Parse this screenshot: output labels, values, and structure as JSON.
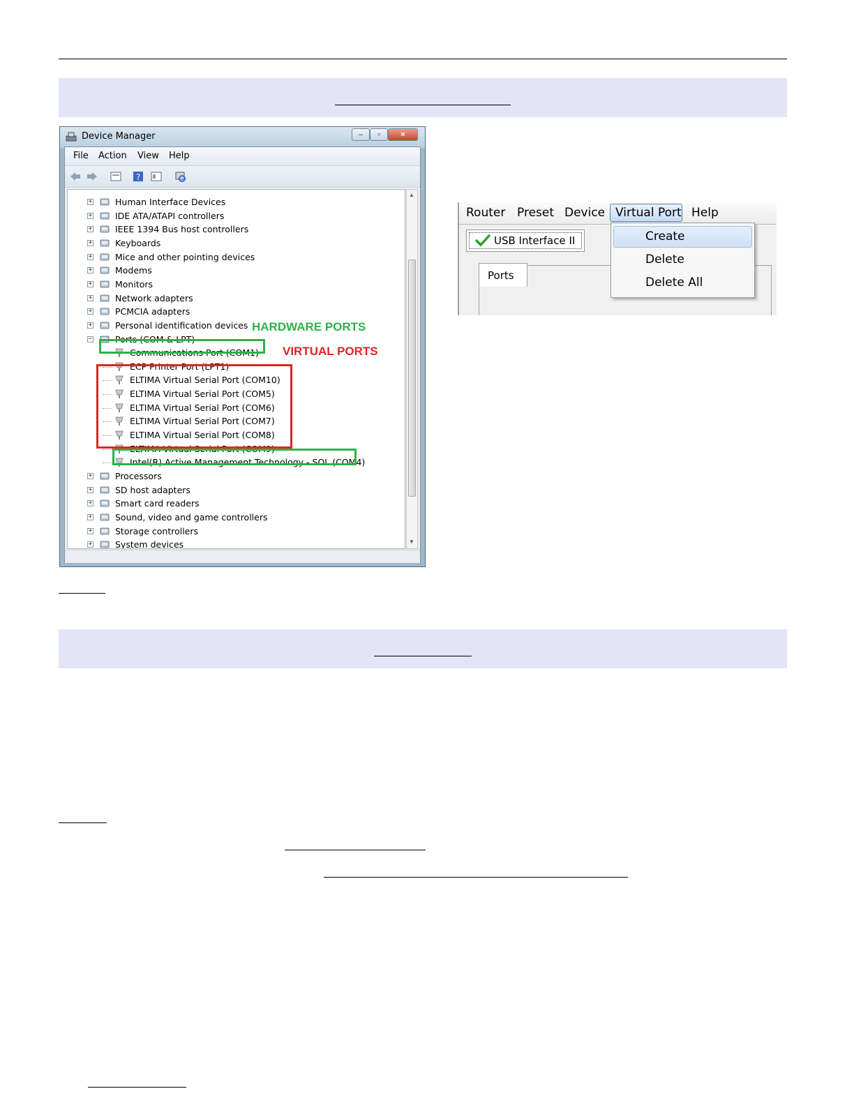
{
  "device_manager": {
    "title": "Device Manager",
    "menu": [
      "File",
      "Action",
      "View",
      "Help"
    ],
    "tree": [
      {
        "label": "Human Interface Devices",
        "level": 0
      },
      {
        "label": "IDE ATA/ATAPI controllers",
        "level": 0
      },
      {
        "label": "IEEE 1394 Bus host controllers",
        "level": 0
      },
      {
        "label": "Keyboards",
        "level": 0
      },
      {
        "label": "Mice and other pointing devices",
        "level": 0
      },
      {
        "label": "Modems",
        "level": 0
      },
      {
        "label": "Monitors",
        "level": 0
      },
      {
        "label": "Network adapters",
        "level": 0
      },
      {
        "label": "PCMCIA adapters",
        "level": 0
      },
      {
        "label": "Personal identification devices",
        "level": 0
      },
      {
        "label": "Ports (COM & LPT)",
        "level": 0,
        "expanded": true
      },
      {
        "label": "Communications Port (COM1)",
        "level": 1
      },
      {
        "label": "ECP Printer Port (LPT1)",
        "level": 1
      },
      {
        "label": "ELTIMA Virtual Serial Port (COM10)",
        "level": 1
      },
      {
        "label": "ELTIMA Virtual Serial Port (COM5)",
        "level": 1
      },
      {
        "label": "ELTIMA Virtual Serial Port (COM6)",
        "level": 1
      },
      {
        "label": "ELTIMA Virtual Serial Port (COM7)",
        "level": 1
      },
      {
        "label": "ELTIMA Virtual Serial Port (COM8)",
        "level": 1
      },
      {
        "label": "ELTIMA Virtual Serial Port (COM9)",
        "level": 1
      },
      {
        "label": "Intel(R) Active Management Technology - SOL (COM4)",
        "level": 1
      },
      {
        "label": "Processors",
        "level": 0
      },
      {
        "label": "SD host adapters",
        "level": 0
      },
      {
        "label": "Smart card readers",
        "level": 0
      },
      {
        "label": "Sound, video and game controllers",
        "level": 0
      },
      {
        "label": "Storage controllers",
        "level": 0
      },
      {
        "label": "System devices",
        "level": 0
      }
    ],
    "annotations": {
      "hardware": "HARDWARE PORTS",
      "virtual": "VIRTUAL PORTS",
      "hardware_color": "#2fb24a",
      "virtual_color": "#e02424"
    }
  },
  "virtual_port_window": {
    "menu": [
      "Router",
      "Preset",
      "Device",
      "Virtual Port",
      "Help"
    ],
    "active_menu": "Virtual Port",
    "device_tab": "USB Interface II",
    "ports_tab": "Ports",
    "dropdown": [
      "Create",
      "Delete",
      "Delete All"
    ]
  },
  "colors": {
    "band": "#e4e4f8"
  }
}
